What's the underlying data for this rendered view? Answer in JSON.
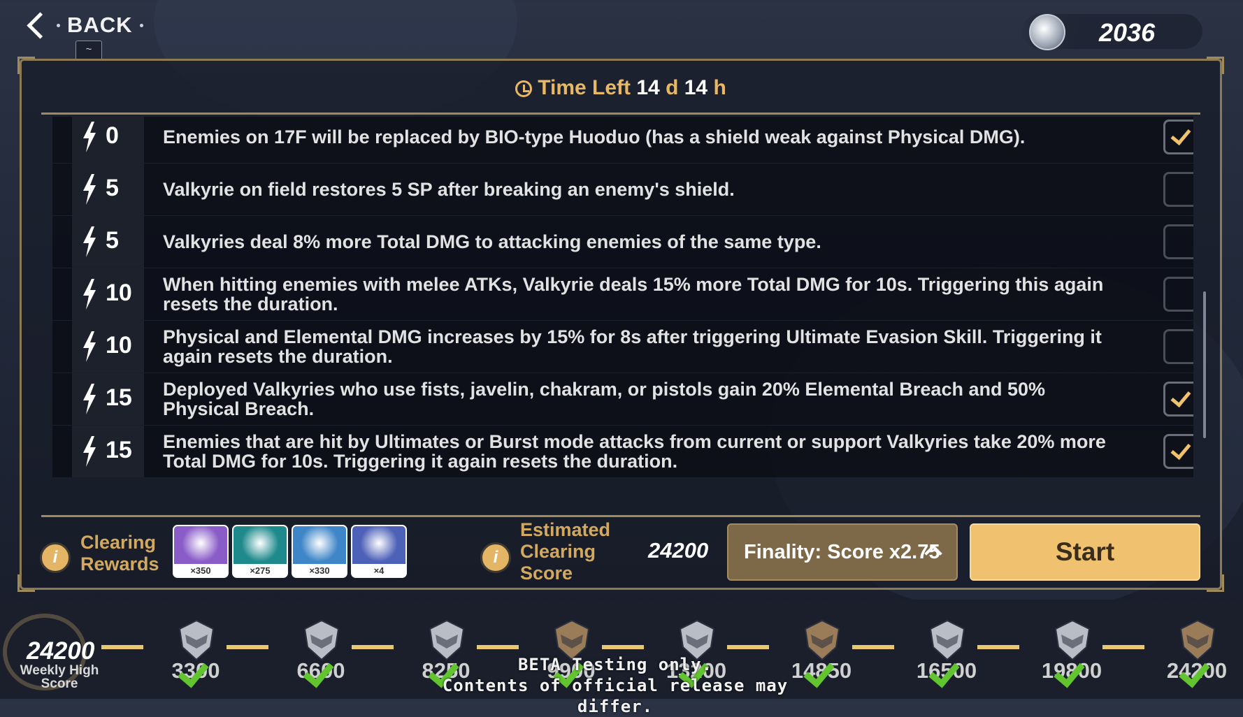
{
  "top": {
    "back_label": "BACK",
    "back_hotkey": "~",
    "currency_icon": "stigmata-crystal-icon",
    "currency_value": "2036"
  },
  "timer": {
    "label": "Time Left",
    "days": "14",
    "days_unit": "d",
    "hours": "14",
    "hours_unit": "h"
  },
  "modifiers": [
    {
      "cost": "0",
      "text": "Enemies on 17F will be replaced by BIO-type Huoduo (has a shield weak against Physical DMG).",
      "checked": true
    },
    {
      "cost": "5",
      "text": "Valkyrie on field restores 5 SP after breaking an enemy's shield.",
      "checked": false
    },
    {
      "cost": "5",
      "text": "Valkyries deal 8% more Total DMG to attacking enemies of the same type.",
      "checked": false
    },
    {
      "cost": "10",
      "text": "When hitting enemies with melee ATKs, Valkyrie deals 15% more Total DMG for 10s. Triggering this again resets the duration.",
      "checked": false
    },
    {
      "cost": "10",
      "text": "Physical and Elemental DMG increases by 15% for 8s after triggering Ultimate Evasion Skill. Triggering it again resets the duration.",
      "checked": false
    },
    {
      "cost": "15",
      "text": "Deployed Valkyries who use fists, javelin, chakram, or pistols gain 20% Elemental Breach and 50% Physical Breach.",
      "checked": true
    },
    {
      "cost": "15",
      "text": "Enemies that are hit by Ultimates or Burst mode attacks from current or support Valkyries take 20% more Total DMG for 10s. Triggering it again resets the duration.",
      "checked": true
    }
  ],
  "rewards": {
    "label": "Clearing Rewards",
    "items": [
      {
        "icon": "valkyrie-emblem-icon",
        "count": "×350",
        "color": "#8a5cc8"
      },
      {
        "icon": "green-disc-icon",
        "count": "×275",
        "color": "#1f8a8c"
      },
      {
        "icon": "crystal-egg-icon",
        "count": "×330",
        "color": "#3f86c8"
      },
      {
        "icon": "pink-flower-icon",
        "count": "×4",
        "color": "#4d61b8"
      }
    ]
  },
  "estimate": {
    "label": "Estimated Clearing Score",
    "value": "24200"
  },
  "finality_label": "Finality: Score x2.75",
  "start_label": "Start",
  "weekly": {
    "value": "24200",
    "label": "Weekly High Score"
  },
  "milestones": [
    {
      "score": "3300",
      "color": "#b9bdc6",
      "reached": true
    },
    {
      "score": "6600",
      "color": "#b9bdc6",
      "reached": true
    },
    {
      "score": "8250",
      "color": "#b9bdc6",
      "reached": true
    },
    {
      "score": "9900",
      "color": "#9a7d58",
      "reached": true
    },
    {
      "score": "13200",
      "color": "#b9bdc6",
      "reached": true
    },
    {
      "score": "14850",
      "color": "#9a7d58",
      "reached": true
    },
    {
      "score": "16500",
      "color": "#b9bdc6",
      "reached": true
    },
    {
      "score": "19800",
      "color": "#b9bdc6",
      "reached": true
    },
    {
      "score": "24200",
      "color": "#9a7d58",
      "reached": true
    }
  ],
  "beta_notice": [
    "BETA Testing only.",
    "Contents of official release may differ."
  ]
}
